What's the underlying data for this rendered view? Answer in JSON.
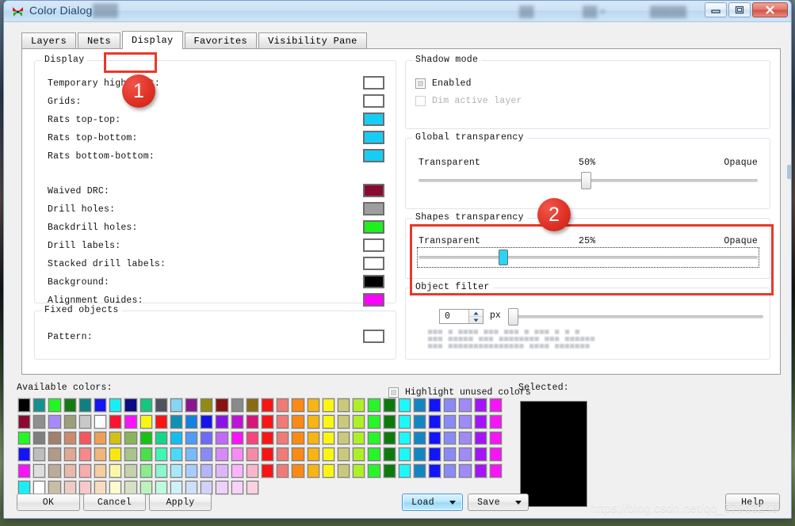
{
  "window": {
    "title": "Color Dialog",
    "icon": "butterfly-app-icon",
    "controls": {
      "minimize": "minimize-icon",
      "maximize": "maximize-icon",
      "close": "close-icon"
    },
    "blurred_titlebar_texts": [
      "███",
      "██",
      "██ ▾",
      "█████"
    ]
  },
  "tabs": [
    {
      "label": "Layers",
      "active": false
    },
    {
      "label": "Nets",
      "active": false
    },
    {
      "label": "Display",
      "active": true
    },
    {
      "label": "Favorites",
      "active": false
    },
    {
      "label": "Visibility Pane",
      "active": false
    }
  ],
  "annotations": [
    {
      "id": "1",
      "target": "display-tab-and-group"
    },
    {
      "id": "2",
      "target": "shapes-transparency-group"
    }
  ],
  "display_group": {
    "legend": "Display",
    "rows": [
      {
        "label": "Temporary highlight:",
        "color": "#ffffff"
      },
      {
        "label": "Grids:",
        "color": "#ffffff"
      },
      {
        "label": "Rats top-top:",
        "color": "#18cdf5"
      },
      {
        "label": "Rats top-bottom:",
        "color": "#18cdf5"
      },
      {
        "label": "Rats bottom-bottom:",
        "color": "#18cdf5"
      },
      {
        "label": "Waived DRC:",
        "color": "#8a0a31"
      },
      {
        "label": "Drill holes:",
        "color": "#9e9e9e"
      },
      {
        "label": "Backdrill holes:",
        "color": "#1fee1f"
      },
      {
        "label": "Drill labels:",
        "color": "#ffffff"
      },
      {
        "label": "Stacked drill labels:",
        "color": "#ffffff"
      },
      {
        "label": "Background:",
        "color": "#000000"
      },
      {
        "label": "Alignment Guides:",
        "color": "#ff00ff"
      }
    ]
  },
  "fixed_objects_group": {
    "legend": "Fixed objects",
    "rows": [
      {
        "label": "Pattern:",
        "color": "#ffffff"
      }
    ]
  },
  "shadow_mode_group": {
    "legend": "Shadow mode",
    "checkboxes": [
      {
        "label": "Enabled",
        "checked": false,
        "disabled": false
      },
      {
        "label": "Dim active layer",
        "checked": false,
        "disabled": true
      }
    ]
  },
  "global_transparency_group": {
    "legend": "Global transparency",
    "left_label": "Transparent",
    "value_label": "50%",
    "right_label": "Opaque",
    "value_percent": 50
  },
  "shapes_transparency_group": {
    "legend": "Shapes transparency",
    "left_label": "Transparent",
    "value_label": "25%",
    "right_label": "Opaque",
    "value_percent": 25,
    "focused": true
  },
  "object_filter_group": {
    "legend": "Object filter",
    "spinner_value": "0",
    "unit_label": "px",
    "slider_percent": 0,
    "faint_rows": [
      "▄▄▄  ▄ ▄▄▄▄        ▄▄▄ ▄▄▄ ▄    ▄▄▄ ▄ ▄ ▄",
      "▄▄▄ ▄▄▄▄▄              ▄▄▄ ▄▄▄▄▄▄▄▄   ▄▄▄ ▄▄▄▄▄▄",
      "▄▄▄ ▄▄▄▄▄▄▄▄▄▄▄▄▄▄▄  ▄▄▄▄  ▄▄▄▄▄▄▄"
    ]
  },
  "palette": {
    "label": "Available colors:",
    "highlight_unused_label": "Highlight unused colors",
    "highlight_unused_checked": false,
    "selected_label": "Selected:",
    "selected_color": "#000000",
    "columns": 32,
    "rows_count": 6,
    "rows": [
      [
        "#000000",
        "#14918f",
        "#23f723",
        "#137b13",
        "#10807f",
        "#1414f5",
        "#17eff5",
        "#0b0b84",
        "#12c87e",
        "#4e5361",
        "#86d6f2",
        "#8a1690",
        "#928a12",
        "#8a1111",
        "#8a8a8a",
        "#8a6b11",
        "#fa1414",
        "#f07b76",
        "#fb8a14",
        "#f8b512",
        "#fbf514",
        "#cac97a",
        "#aef028",
        "#28f528",
        "#0d7a0d",
        "#1ef7f7",
        "#1286c4",
        "#1414fa",
        "#8a8af7",
        "#a08af7",
        "#a514f7",
        "#f714f7"
      ],
      [
        "#8a0a31",
        "#8f8f8f",
        "#a78af7",
        "#9e9e78",
        "#c8c8c8",
        "#ffffff",
        "#fa1430",
        "#f714f7",
        "#f7f714",
        "#fa1414",
        "#128fb5",
        "#1480e0",
        "#1414e8",
        "#8a14e8",
        "#bd14d6",
        "#d6147a",
        "#fa1414",
        "#f07b76",
        "#fb8a14",
        "#f8b512",
        "#fbf514",
        "#cac97a",
        "#aef028",
        "#28f528",
        "#0d7a0d",
        "#1ef7f7",
        "#1286c4",
        "#1414fa",
        "#8a8af7",
        "#a08af7",
        "#a514f7",
        "#f714f7"
      ],
      [
        "#23f723",
        "#7f7f7f",
        "#a1806d",
        "#cd8a6d",
        "#f5565c",
        "#eda055",
        "#d1c117",
        "#8ab45c",
        "#14c414",
        "#14d68a",
        "#14bdf0",
        "#4f9cf5",
        "#6b6bf7",
        "#c06bf7",
        "#f714f7",
        "#f7447f",
        "#fa1414",
        "#f07b76",
        "#fb8a14",
        "#f8b512",
        "#fbf514",
        "#cac97a",
        "#aef028",
        "#28f528",
        "#0d7a0d",
        "#1ef7f7",
        "#1286c4",
        "#1414fa",
        "#8a8af7",
        "#a08af7",
        "#a514f7",
        "#f714f7"
      ],
      [
        "#1414fa",
        "#bdbdbd",
        "#b09a8a",
        "#e0a894",
        "#f7888c",
        "#f0b578",
        "#f7e814",
        "#a8c48a",
        "#4ae04a",
        "#3ef7b5",
        "#4ad9fa",
        "#7ab8fa",
        "#8a8af7",
        "#d68af7",
        "#f78af7",
        "#f78aa8",
        "#fa1414",
        "#f07b76",
        "#fb8a14",
        "#f8b512",
        "#fbf514",
        "#cac97a",
        "#aef028",
        "#28f528",
        "#0d7a0d",
        "#1ef7f7",
        "#1286c4",
        "#1414fa",
        "#8a8af7",
        "#a08af7",
        "#a514f7",
        "#f714f7"
      ],
      [
        "#f714f7",
        "#dedede",
        "#bdab99",
        "#e8b8ab",
        "#f7adad",
        "#f5cd9e",
        "#fbf7a8",
        "#c4d1ab",
        "#8ceb8c",
        "#8cf7cd",
        "#a8e8fa",
        "#a8cdfa",
        "#b5b5fa",
        "#dfb5fa",
        "#fab5fa",
        "#fab5cd",
        "#fa1414",
        "#f07b76",
        "#fb8a14",
        "#f8b512",
        "#fbf514",
        "#cac97a",
        "#aef028",
        "#28f528",
        "#0d7a0d",
        "#1ef7f7",
        "#1286c4",
        "#1414fa",
        "#8a8af7",
        "#a08af7",
        "#a514f7",
        "#f714f7"
      ],
      [
        "#17eff5",
        "#ffffff",
        "#c9bda8",
        "#ebcdc4",
        "#f7c9c9",
        "#f7ddbd",
        "#fbfbce",
        "#d6e0c4",
        "#bdf2bd",
        "#bdfade",
        "#cdf2fa",
        "#cde0fa",
        "#d1d1fa",
        "#eed1fa",
        "#fad1fa",
        "#fad1e0"
      ]
    ]
  },
  "buttons": {
    "ok": "OK",
    "cancel": "Cancel",
    "apply": "Apply",
    "load": "Load",
    "save": "Save",
    "help": "Help"
  },
  "watermark": "https://blog.csdn.net/qq_37963248",
  "colors": {
    "annotation_red": "#e8392a",
    "accent_blue": "#95d9f7",
    "cyan_thumb": "#2ad3f7"
  }
}
